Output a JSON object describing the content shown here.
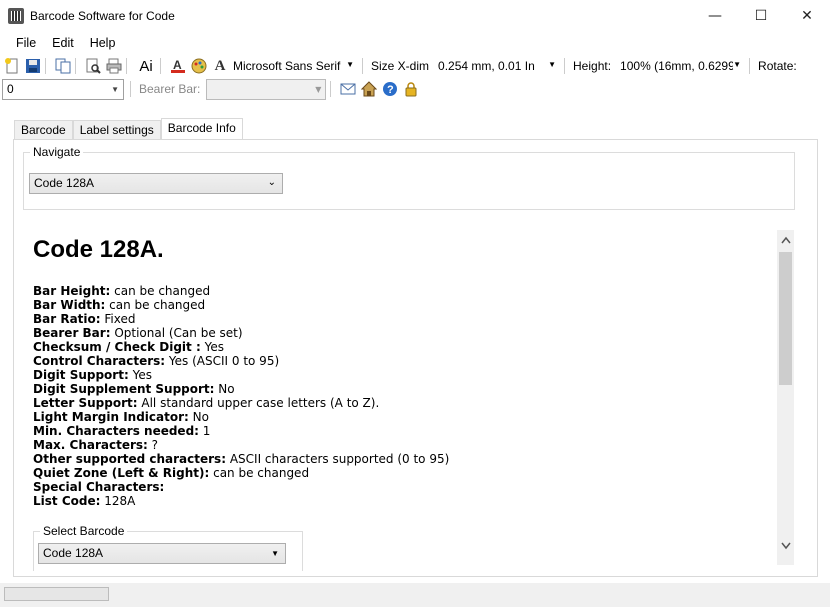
{
  "window": {
    "title": "Barcode Software for Code",
    "minimize_glyph": "—",
    "maximize_glyph": "☐",
    "close_glyph": "✕"
  },
  "menu": [
    "File",
    "Edit",
    "Help"
  ],
  "toolbar": {
    "font_icon_label": "Ai",
    "font_a_label": "A",
    "font_combo": "Microsoft Sans Serif",
    "size_label": "Size X-dim",
    "size_value": "0.254 mm, 0.01 In",
    "height_label": "Height:",
    "height_value": "100% (16mm, 0.6299",
    "rotate_label": "Rotate:",
    "rotate_value": "0",
    "bearer_label": "Bearer Bar:",
    "bearer_value": ""
  },
  "tabs": [
    "Barcode",
    "Label settings",
    "Barcode Info"
  ],
  "navigate": {
    "title": "Navigate",
    "selected": "Code 128A"
  },
  "info": {
    "heading": "Code 128A.",
    "properties": [
      {
        "key": "Bar Height:",
        "value": " can be changed"
      },
      {
        "key": "Bar Width:",
        "value": " can be changed"
      },
      {
        "key": "Bar Ratio:",
        "value": " Fixed"
      },
      {
        "key": "Bearer Bar:",
        "value": " Optional (Can be set)"
      },
      {
        "key": "Checksum / Check Digit :",
        "value": " Yes"
      },
      {
        "key": "Control Characters:",
        "value": " Yes (ASCII 0 to 95)"
      },
      {
        "key": "Digit Support:",
        "value": " Yes"
      },
      {
        "key": "Digit Supplement Support:",
        "value": " No"
      },
      {
        "key": "Letter Support:",
        "value": " All standard upper case letters (A to Z)."
      },
      {
        "key": "Light Margin Indicator:",
        "value": " No"
      },
      {
        "key": "Min. Characters needed:",
        "value": " 1"
      },
      {
        "key": "Max. Characters:",
        "value": " ?"
      },
      {
        "key": "Other supported characters:",
        "value": " ASCII characters supported (0 to 95)"
      },
      {
        "key": "Quiet Zone (Left & Right):",
        "value": " can be changed"
      },
      {
        "key": "Special Characters:",
        "value": ""
      },
      {
        "key": "List Code:",
        "value": " 128A"
      }
    ]
  },
  "select_barcode": {
    "title": "Select Barcode",
    "selected": "Code 128A"
  },
  "colors": {
    "accent_red": "#d42b1e",
    "help_blue": "#2a6dc9"
  }
}
